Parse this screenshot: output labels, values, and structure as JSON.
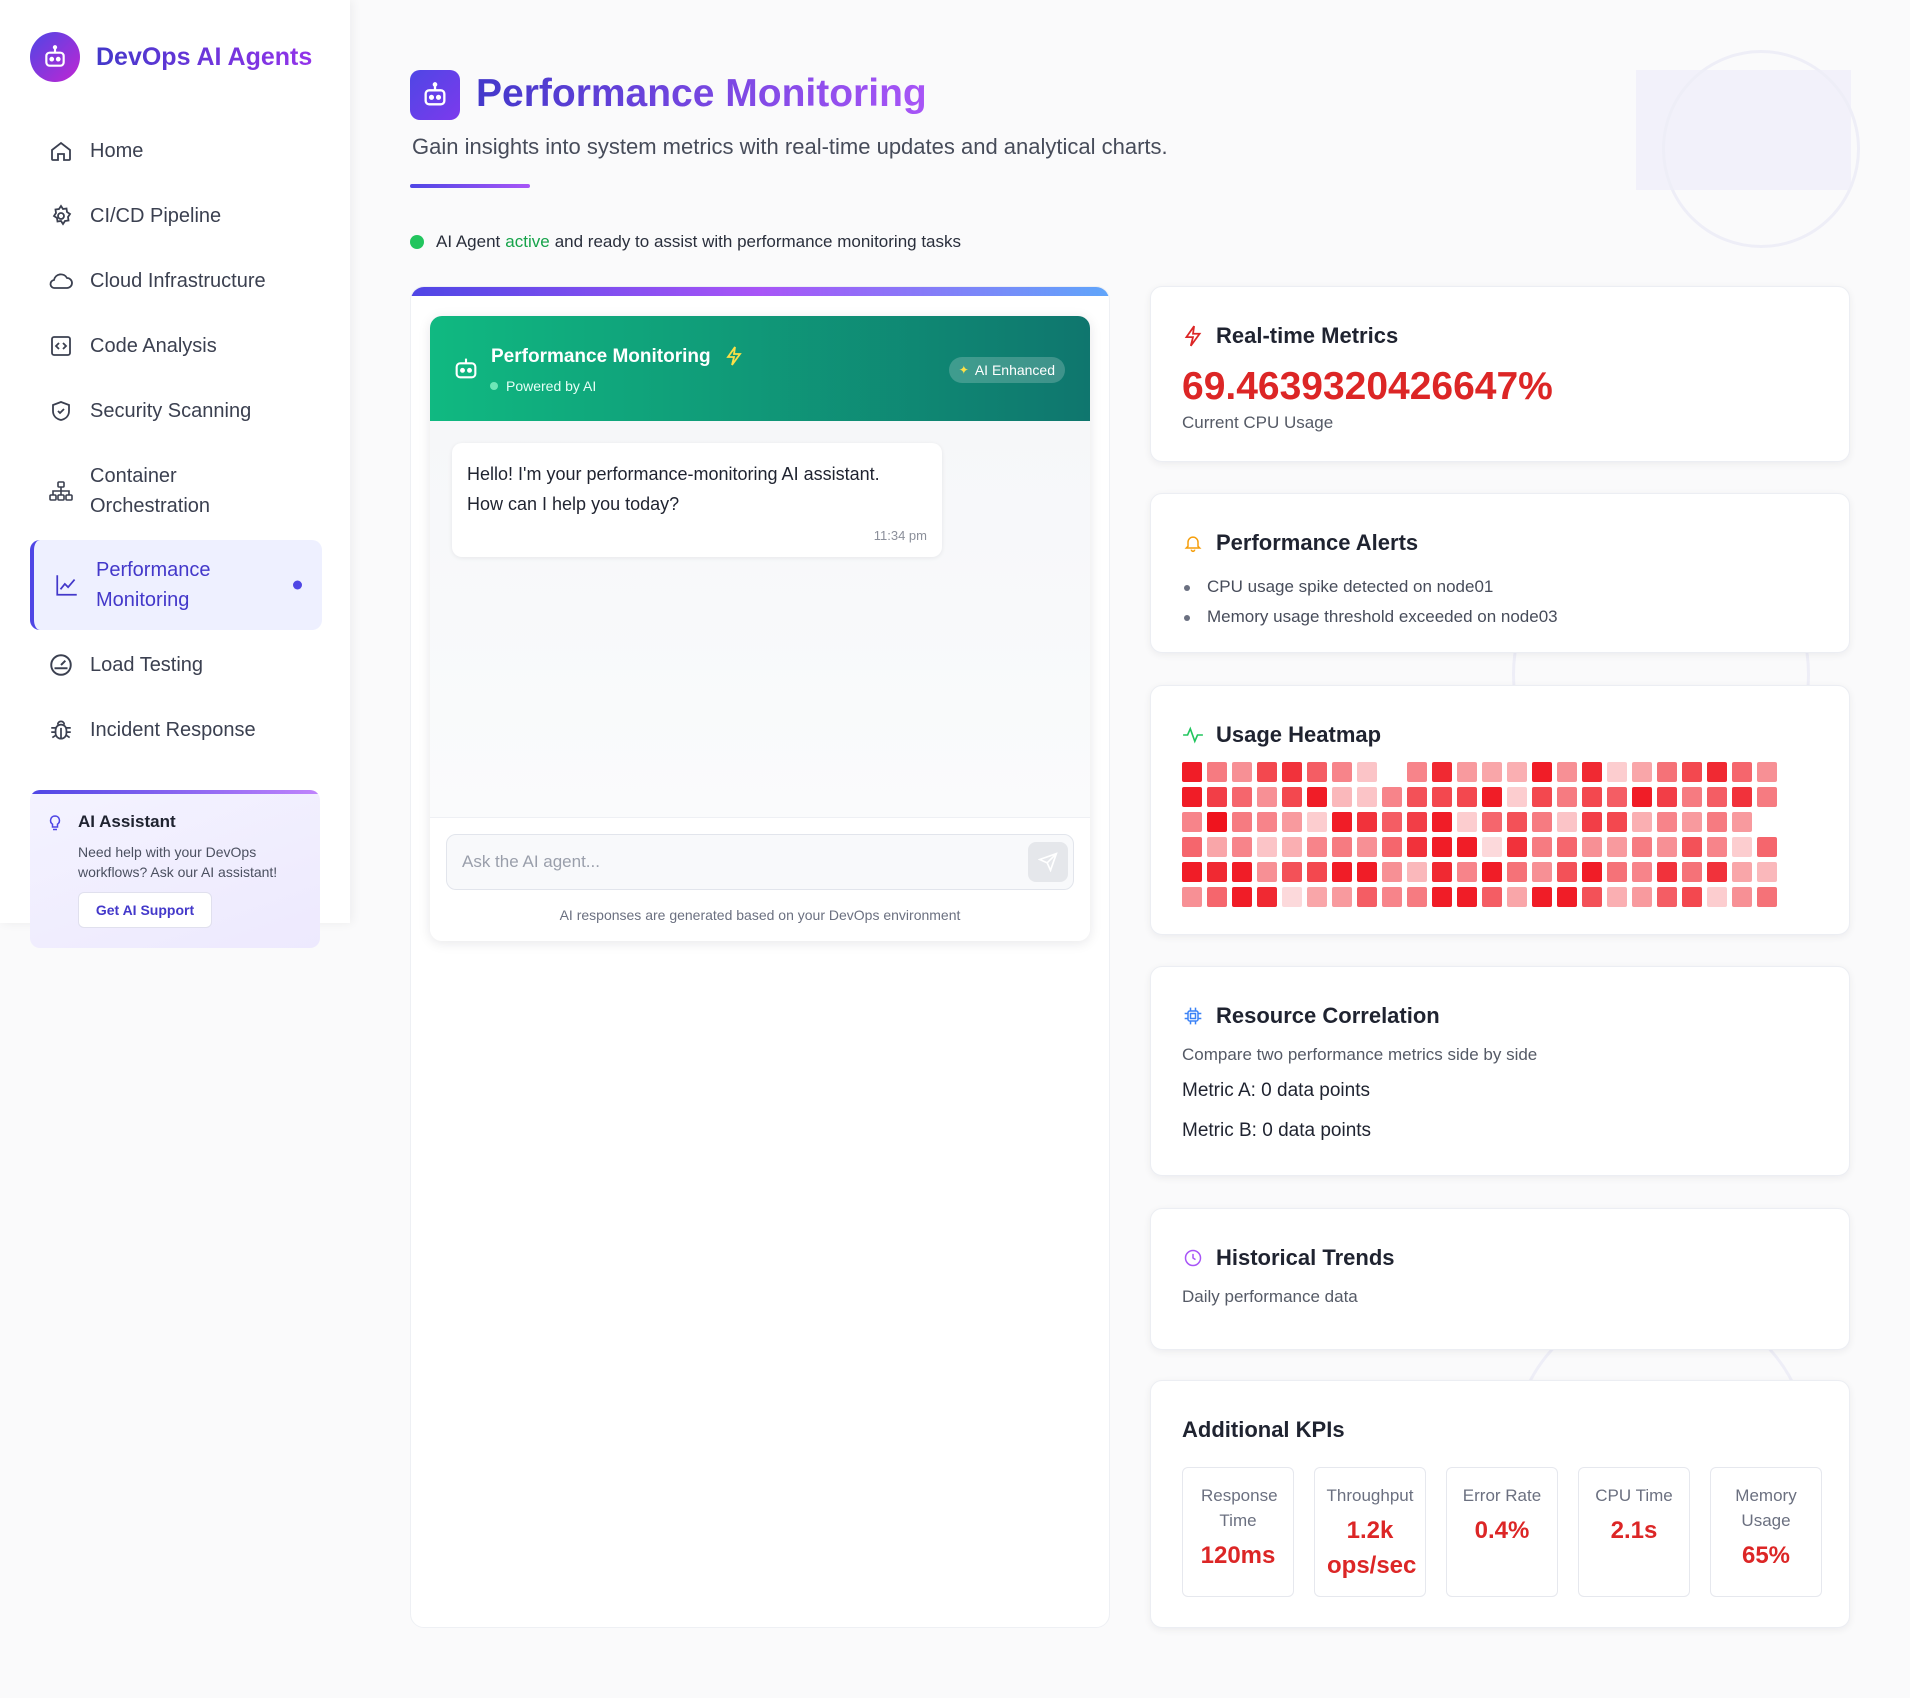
{
  "app": {
    "brand": "DevOps AI Agents"
  },
  "sidebar": {
    "items": [
      {
        "label": "Home",
        "icon": "home-icon"
      },
      {
        "label": "CI/CD Pipeline",
        "icon": "gear-icon"
      },
      {
        "label": "Cloud Infrastructure",
        "icon": "cloud-icon"
      },
      {
        "label": "Code Analysis",
        "icon": "code-icon"
      },
      {
        "label": "Security Scanning",
        "icon": "shield-icon"
      },
      {
        "label": "Container Orchestration",
        "icon": "network-icon"
      },
      {
        "label": "Performance Monitoring",
        "icon": "chart-line-icon",
        "active": true
      },
      {
        "label": "Load Testing",
        "icon": "gauge-icon"
      },
      {
        "label": "Incident Response",
        "icon": "bug-icon"
      }
    ],
    "assistant": {
      "title": "AI Assistant",
      "text": "Need help with your DevOps workflows? Ask our AI assistant!",
      "button": "Get AI Support"
    }
  },
  "header": {
    "title": "Performance Monitoring",
    "subtitle": "Gain insights into system metrics with real-time updates and analytical charts.",
    "status_prefix": "AI Agent",
    "status_active": "active",
    "status_suffix": "and ready to assist with performance monitoring tasks"
  },
  "chat": {
    "title": "Performance Monitoring",
    "powered": "Powered by AI",
    "badge": "AI Enhanced",
    "message": "Hello! I'm your performance-monitoring AI assistant. How can I help you today?",
    "time": "11:34 pm",
    "placeholder": "Ask the AI agent...",
    "note": "AI responses are generated based on your DevOps environment"
  },
  "realtime": {
    "title": "Real-time Metrics",
    "value": "69.4639320426647%",
    "label": "Current CPU Usage"
  },
  "alerts": {
    "title": "Performance Alerts",
    "items": [
      "CPU usage spike detected on node01",
      "Memory usage threshold exceeded on node03"
    ]
  },
  "heatmap": {
    "title": "Usage Heatmap",
    "rows": 6,
    "cols": 24,
    "intensities": [
      [
        0.95,
        0.5,
        0.4,
        0.75,
        0.85,
        0.65,
        0.45,
        0.15,
        0.0,
        0.45,
        0.9,
        0.35,
        0.3,
        0.25,
        0.95,
        0.4,
        0.9,
        0.1,
        0.3,
        0.55,
        0.75,
        0.9,
        0.6,
        0.4
      ],
      [
        0.95,
        0.8,
        0.6,
        0.4,
        0.75,
        0.95,
        0.2,
        0.15,
        0.45,
        0.7,
        0.75,
        0.75,
        0.95,
        0.1,
        0.75,
        0.5,
        0.75,
        0.65,
        0.95,
        0.8,
        0.5,
        0.65,
        0.85,
        0.5
      ],
      [
        0.45,
        1.0,
        0.5,
        0.45,
        0.35,
        0.1,
        0.95,
        0.85,
        0.65,
        0.8,
        0.95,
        0.1,
        0.6,
        0.7,
        0.5,
        0.15,
        0.8,
        0.75,
        0.25,
        0.45,
        0.35,
        0.5,
        0.35,
        0.0
      ],
      [
        0.6,
        0.3,
        0.45,
        0.15,
        0.25,
        0.45,
        0.5,
        0.4,
        0.6,
        0.85,
        0.95,
        0.95,
        0.05,
        0.85,
        0.5,
        0.6,
        0.4,
        0.35,
        0.5,
        0.4,
        0.7,
        0.45,
        0.1,
        0.6
      ],
      [
        0.95,
        0.9,
        0.95,
        0.4,
        0.7,
        0.75,
        0.95,
        0.95,
        0.4,
        0.2,
        0.9,
        0.45,
        0.95,
        0.55,
        0.4,
        0.7,
        0.95,
        0.55,
        0.45,
        0.85,
        0.55,
        0.85,
        0.3,
        0.2
      ],
      [
        0.4,
        0.6,
        0.95,
        0.9,
        0.05,
        0.3,
        0.35,
        0.65,
        0.45,
        0.5,
        0.95,
        0.95,
        0.65,
        0.3,
        0.95,
        0.95,
        0.7,
        0.25,
        0.35,
        0.65,
        0.75,
        0.1,
        0.4,
        0.55
      ]
    ]
  },
  "correlation": {
    "title": "Resource Correlation",
    "subtitle": "Compare two performance metrics side by side",
    "metric_a": "Metric A: 0 data points",
    "metric_b": "Metric B: 0 data points"
  },
  "historical": {
    "title": "Historical Trends",
    "subtitle": "Daily performance data"
  },
  "kpis": {
    "title": "Additional KPIs",
    "items": [
      {
        "label": "Response Time",
        "value": "120ms"
      },
      {
        "label": "Throughput",
        "value": "1.2k ops/sec"
      },
      {
        "label": "Error Rate",
        "value": "0.4%"
      },
      {
        "label": "CPU Time",
        "value": "2.1s"
      },
      {
        "label": "Memory Usage",
        "value": "65%"
      }
    ]
  },
  "colors": {
    "accent": "#4f46e5",
    "purple": "#a855f7",
    "chat_header": "#10b981",
    "metric_red": "#dc2626",
    "status_green": "#22c55e"
  }
}
